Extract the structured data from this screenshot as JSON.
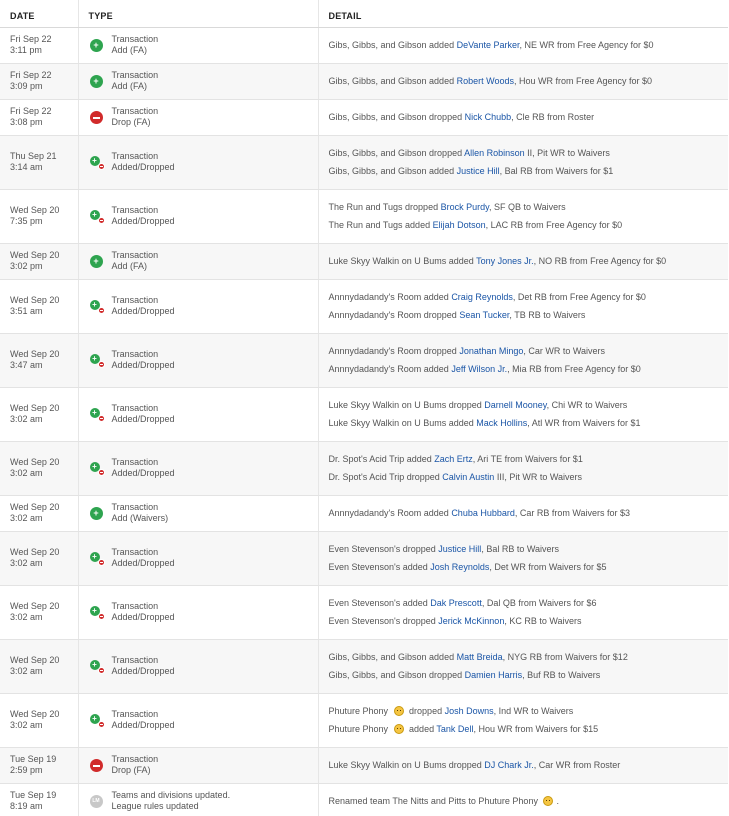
{
  "headers": {
    "date": "DATE",
    "type": "TYPE",
    "detail": "DETAIL"
  },
  "colors": {
    "add": "#2ea44f",
    "drop": "#d12b2b",
    "link": "#1a55a6"
  },
  "rows": [
    {
      "h": 36,
      "day": "Fri Sep 22",
      "time": "3:11 pm",
      "icon": "add-icon",
      "type1": "Transaction",
      "type2": "Add (FA)",
      "lines": [
        [
          {
            "t": "Gibs, Gibbs, and Gibson added "
          },
          {
            "t": "DeVante Parker",
            "l": 1
          },
          {
            "t": ", NE WR from Free Agency for $0"
          }
        ]
      ]
    },
    {
      "h": 36,
      "day": "Fri Sep 22",
      "time": "3:09 pm",
      "icon": "add-icon",
      "type1": "Transaction",
      "type2": "Add (FA)",
      "lines": [
        [
          {
            "t": "Gibs, Gibbs, and Gibson added "
          },
          {
            "t": "Robert Woods",
            "l": 1
          },
          {
            "t": ", Hou WR from Free Agency for $0"
          }
        ]
      ]
    },
    {
      "h": 36,
      "day": "Fri Sep 22",
      "time": "3:08 pm",
      "icon": "drop-icon",
      "type1": "Transaction",
      "type2": "Drop (FA)",
      "lines": [
        [
          {
            "t": "Gibs, Gibbs, and Gibson dropped "
          },
          {
            "t": "Nick Chubb",
            "l": 1
          },
          {
            "t": ", Cle RB from Roster"
          }
        ]
      ]
    },
    {
      "h": 54,
      "day": "Thu Sep 21",
      "time": "3:14 am",
      "icon": "added-dropped-icon",
      "type1": "Transaction",
      "type2": "Added/Dropped",
      "lines": [
        [
          {
            "t": "Gibs, Gibbs, and Gibson dropped "
          },
          {
            "t": "Allen Robinson",
            "l": 1
          },
          {
            "t": " II, Pit WR to Waivers"
          }
        ],
        [
          {
            "t": "Gibs, Gibbs, and Gibson added "
          },
          {
            "t": "Justice Hill",
            "l": 1
          },
          {
            "t": ", Bal RB from Waivers for $1"
          }
        ]
      ]
    },
    {
      "h": 54,
      "day": "Wed Sep 20",
      "time": "7:35 pm",
      "icon": "added-dropped-icon",
      "type1": "Transaction",
      "type2": "Added/Dropped",
      "lines": [
        [
          {
            "t": "The Run and Tugs dropped "
          },
          {
            "t": "Brock Purdy",
            "l": 1
          },
          {
            "t": ", SF QB to Waivers"
          }
        ],
        [
          {
            "t": "The Run and Tugs added "
          },
          {
            "t": "Elijah Dotson",
            "l": 1
          },
          {
            "t": ", LAC RB from Free Agency for $0"
          }
        ]
      ]
    },
    {
      "h": 36,
      "day": "Wed Sep 20",
      "time": "3:02 pm",
      "icon": "add-icon",
      "type1": "Transaction",
      "type2": "Add (FA)",
      "lines": [
        [
          {
            "t": "Luke Skyy Walkin on U Bums added "
          },
          {
            "t": "Tony Jones Jr.",
            "l": 1
          },
          {
            "t": ", NO RB from Free Agency for $0"
          }
        ]
      ]
    },
    {
      "h": 54,
      "day": "Wed Sep 20",
      "time": "3:51 am",
      "icon": "added-dropped-icon",
      "type1": "Transaction",
      "type2": "Added/Dropped",
      "lines": [
        [
          {
            "t": "Annnydadandy's Room added "
          },
          {
            "t": "Craig Reynolds",
            "l": 1
          },
          {
            "t": ", Det RB from Free Agency for $0"
          }
        ],
        [
          {
            "t": "Annnydadandy's Room dropped "
          },
          {
            "t": "Sean Tucker",
            "l": 1
          },
          {
            "t": ", TB RB to Waivers"
          }
        ]
      ]
    },
    {
      "h": 54,
      "day": "Wed Sep 20",
      "time": "3:47 am",
      "icon": "added-dropped-icon",
      "type1": "Transaction",
      "type2": "Added/Dropped",
      "lines": [
        [
          {
            "t": "Annnydadandy's Room dropped "
          },
          {
            "t": "Jonathan Mingo",
            "l": 1
          },
          {
            "t": ", Car WR to Waivers"
          }
        ],
        [
          {
            "t": "Annnydadandy's Room added "
          },
          {
            "t": "Jeff Wilson Jr.",
            "l": 1
          },
          {
            "t": ", Mia RB from Free Agency for $0"
          }
        ]
      ]
    },
    {
      "h": 54,
      "day": "Wed Sep 20",
      "time": "3:02 am",
      "icon": "added-dropped-icon",
      "type1": "Transaction",
      "type2": "Added/Dropped",
      "lines": [
        [
          {
            "t": "Luke Skyy Walkin on U Bums dropped "
          },
          {
            "t": "Darnell Mooney",
            "l": 1
          },
          {
            "t": ", Chi WR to Waivers"
          }
        ],
        [
          {
            "t": "Luke Skyy Walkin on U Bums added "
          },
          {
            "t": "Mack Hollins",
            "l": 1
          },
          {
            "t": ", Atl WR from Waivers for $1"
          }
        ]
      ]
    },
    {
      "h": 54,
      "day": "Wed Sep 20",
      "time": "3:02 am",
      "icon": "added-dropped-icon",
      "type1": "Transaction",
      "type2": "Added/Dropped",
      "lines": [
        [
          {
            "t": "Dr. Spot's Acid Trip added "
          },
          {
            "t": "Zach Ertz",
            "l": 1
          },
          {
            "t": ", Ari TE from Waivers for $1"
          }
        ],
        [
          {
            "t": "Dr. Spot's Acid Trip dropped "
          },
          {
            "t": "Calvin Austin",
            "l": 1
          },
          {
            "t": " III, Pit WR to Waivers"
          }
        ]
      ]
    },
    {
      "h": 36,
      "day": "Wed Sep 20",
      "time": "3:02 am",
      "icon": "add-icon",
      "type1": "Transaction",
      "type2": "Add (Waivers)",
      "lines": [
        [
          {
            "t": "Annnydadandy's Room added "
          },
          {
            "t": "Chuba Hubbard",
            "l": 1
          },
          {
            "t": ", Car RB from Waivers for $3"
          }
        ]
      ]
    },
    {
      "h": 54,
      "day": "Wed Sep 20",
      "time": "3:02 am",
      "icon": "added-dropped-icon",
      "type1": "Transaction",
      "type2": "Added/Dropped",
      "lines": [
        [
          {
            "t": "Even Stevenson's dropped "
          },
          {
            "t": "Justice Hill",
            "l": 1
          },
          {
            "t": ", Bal RB to Waivers"
          }
        ],
        [
          {
            "t": "Even Stevenson's added "
          },
          {
            "t": "Josh Reynolds",
            "l": 1
          },
          {
            "t": ", Det WR from Waivers for $5"
          }
        ]
      ]
    },
    {
      "h": 54,
      "day": "Wed Sep 20",
      "time": "3:02 am",
      "icon": "added-dropped-icon",
      "type1": "Transaction",
      "type2": "Added/Dropped",
      "lines": [
        [
          {
            "t": "Even Stevenson's added "
          },
          {
            "t": "Dak Prescott",
            "l": 1
          },
          {
            "t": ", Dal QB from Waivers for $6"
          }
        ],
        [
          {
            "t": "Even Stevenson's dropped "
          },
          {
            "t": "Jerick McKinnon",
            "l": 1
          },
          {
            "t": ", KC RB to Waivers"
          }
        ]
      ]
    },
    {
      "h": 54,
      "day": "Wed Sep 20",
      "time": "3:02 am",
      "icon": "added-dropped-icon",
      "type1": "Transaction",
      "type2": "Added/Dropped",
      "lines": [
        [
          {
            "t": "Gibs, Gibbs, and Gibson added "
          },
          {
            "t": "Matt Breida",
            "l": 1
          },
          {
            "t": ", NYG RB from Waivers for $12"
          }
        ],
        [
          {
            "t": "Gibs, Gibbs, and Gibson dropped "
          },
          {
            "t": "Damien Harris",
            "l": 1
          },
          {
            "t": ", Buf RB to Waivers"
          }
        ]
      ]
    },
    {
      "h": 54,
      "day": "Wed Sep 20",
      "time": "3:02 am",
      "icon": "added-dropped-icon",
      "type1": "Transaction",
      "type2": "Added/Dropped",
      "lines": [
        [
          {
            "t": "Phuture Phony "
          },
          {
            "e": "emoji-face-icon"
          },
          {
            "t": " dropped "
          },
          {
            "t": "Josh Downs",
            "l": 1
          },
          {
            "t": ", Ind WR to Waivers"
          }
        ],
        [
          {
            "t": "Phuture Phony "
          },
          {
            "e": "emoji-face-icon"
          },
          {
            "t": " added "
          },
          {
            "t": "Tank Dell",
            "l": 1
          },
          {
            "t": ", Hou WR from Waivers for $15"
          }
        ]
      ]
    },
    {
      "h": 36,
      "day": "Tue Sep 19",
      "time": "2:59 pm",
      "icon": "drop-icon",
      "type1": "Transaction",
      "type2": "Drop (FA)",
      "lines": [
        [
          {
            "t": "Luke Skyy Walkin on U Bums dropped "
          },
          {
            "t": "DJ Chark Jr.",
            "l": 1
          },
          {
            "t": ", Car WR from Roster"
          }
        ]
      ]
    },
    {
      "h": 36,
      "day": "Tue Sep 19",
      "time": "8:19 am",
      "icon": "league-manager-icon",
      "type1": "Teams and divisions updated.",
      "type2": "League rules updated",
      "lines": [
        [
          {
            "t": "Renamed team The Nitts and Pitts to Phuture Phony "
          },
          {
            "e": "emoji-face-icon"
          },
          {
            "t": "."
          }
        ]
      ]
    }
  ]
}
